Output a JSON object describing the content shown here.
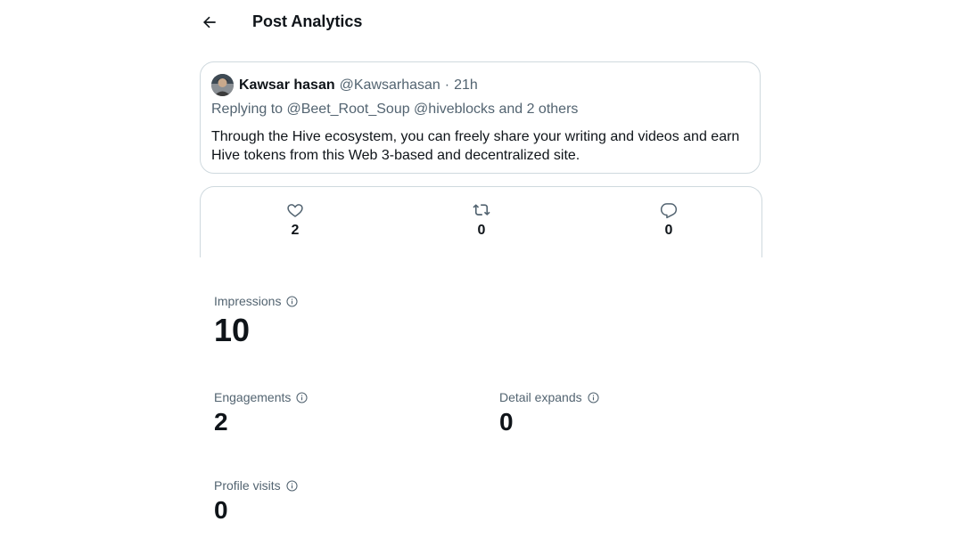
{
  "header": {
    "title": "Post Analytics"
  },
  "tweet": {
    "author_name": "Kawsar hasan",
    "handle": "@Kawsarhasan",
    "separator": "·",
    "time": "21h",
    "replying": "Replying to @Beet_Root_Soup @hiveblocks and 2 others",
    "text": "Through the Hive ecosystem, you can freely share your writing and videos and earn Hive tokens from this Web 3-based and decentralized site."
  },
  "stats": {
    "likes": "2",
    "reposts": "0",
    "replies": "0"
  },
  "metrics": {
    "impressions": {
      "label": "Impressions",
      "value": "10"
    },
    "engagements": {
      "label": "Engagements",
      "value": "2"
    },
    "detail_expands": {
      "label": "Detail expands",
      "value": "0"
    },
    "profile_visits": {
      "label": "Profile visits",
      "value": "0"
    }
  },
  "icons": [
    "back-arrow-icon",
    "heart-icon",
    "repost-icon",
    "reply-icon",
    "info-icon"
  ],
  "colors": {
    "text": "#0f1419",
    "secondary": "#536471",
    "border": "#cfd9de"
  }
}
